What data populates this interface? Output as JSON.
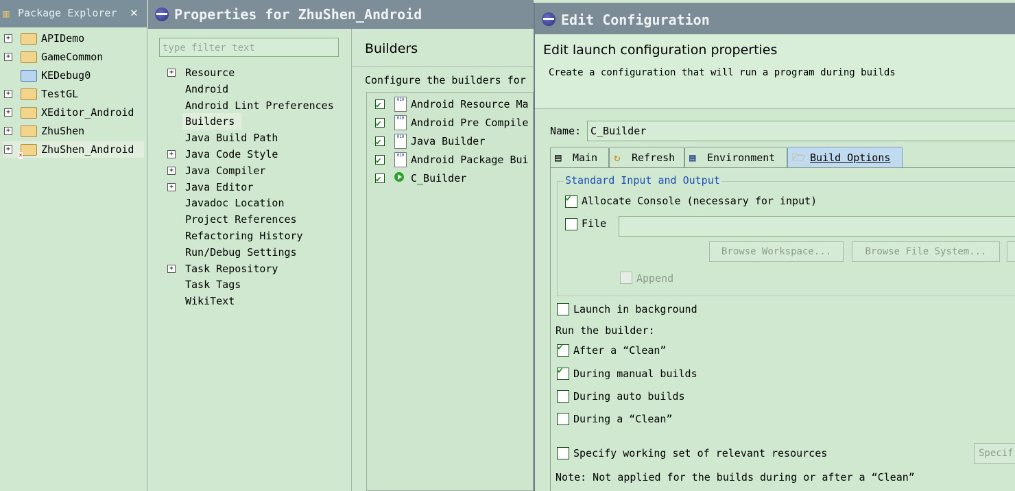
{
  "package_explorer": {
    "title": "Package Explorer",
    "projects": [
      {
        "label": "APIDemo",
        "icon": "project-folder-icon",
        "expandable": true
      },
      {
        "label": "GameCommon",
        "icon": "project-folder-icon",
        "expandable": true
      },
      {
        "label": "KEDebug0",
        "icon": "plain-folder-icon",
        "expandable": false
      },
      {
        "label": "TestGL",
        "icon": "project-folder-icon",
        "expandable": true
      },
      {
        "label": "XEditor_Android",
        "icon": "project-folder-icon",
        "expandable": true
      },
      {
        "label": "ZhuShen",
        "icon": "project-folder-icon",
        "expandable": true
      },
      {
        "label": "ZhuShen_Android",
        "icon": "project-error-icon",
        "expandable": true
      }
    ]
  },
  "properties": {
    "title": "Properties for ZhuShen_Android",
    "filter_placeholder": "type filter text",
    "nav": [
      {
        "label": "Resource",
        "expandable": true
      },
      {
        "label": "Android",
        "expandable": false
      },
      {
        "label": "Android Lint Preferences",
        "expandable": false
      },
      {
        "label": "Builders",
        "expandable": false,
        "selected": true
      },
      {
        "label": "Java Build Path",
        "expandable": false
      },
      {
        "label": "Java Code Style",
        "expandable": true
      },
      {
        "label": "Java Compiler",
        "expandable": true
      },
      {
        "label": "Java Editor",
        "expandable": true
      },
      {
        "label": "Javadoc Location",
        "expandable": false
      },
      {
        "label": "Project References",
        "expandable": false
      },
      {
        "label": "Refactoring History",
        "expandable": false
      },
      {
        "label": "Run/Debug Settings",
        "expandable": false
      },
      {
        "label": "Task Repository",
        "expandable": true
      },
      {
        "label": "Task Tags",
        "expandable": false
      },
      {
        "label": "WikiText",
        "expandable": false
      }
    ],
    "page_title": "Builders",
    "page_desc": "Configure the builders for",
    "builders": [
      {
        "label": "Android Resource Ma",
        "checked": true,
        "icon": "binary-builder-icon"
      },
      {
        "label": "Android Pre Compile",
        "checked": true,
        "icon": "binary-builder-icon"
      },
      {
        "label": "Java Builder",
        "checked": true,
        "icon": "binary-builder-icon"
      },
      {
        "label": "Android Package Bui",
        "checked": true,
        "icon": "binary-builder-icon"
      },
      {
        "label": "C_Builder",
        "checked": true,
        "icon": "program-builder-icon"
      }
    ]
  },
  "edit_config": {
    "title": "Edit Configuration",
    "header_title": "Edit launch configuration properties",
    "header_desc": "Create a configuration that will run a program during builds",
    "name_label": "Name:",
    "name_value": "C_Builder",
    "tabs": [
      {
        "label": "Main",
        "icon": "main-tab-icon",
        "active": false
      },
      {
        "label": "Refresh",
        "icon": "refresh-icon",
        "active": false
      },
      {
        "label": "Environment",
        "icon": "environment-icon",
        "active": false
      },
      {
        "label": "Build Options",
        "icon": "open-folder-icon",
        "active": true
      }
    ],
    "io_group_label": "Standard Input and Output",
    "allocate_console": {
      "label": "Allocate Console (necessary for input)",
      "checked": true
    },
    "file": {
      "label": "File",
      "checked": false,
      "value": ""
    },
    "browse_workspace": "Browse Workspace...",
    "browse_filesystem": "Browse File System...",
    "append": {
      "label": "Append",
      "checked": false
    },
    "launch_background": {
      "label": "Launch in background",
      "checked": false
    },
    "run_builder_label": "Run the builder:",
    "after_clean": {
      "label": "After a “Clean”",
      "checked": true
    },
    "during_manual": {
      "label": "During manual builds",
      "checked": true
    },
    "during_auto": {
      "label": "During auto builds",
      "checked": false
    },
    "during_clean": {
      "label": "During a “Clean”",
      "checked": false
    },
    "working_set": {
      "label": "Specify working set of relevant resources",
      "checked": false
    },
    "specify_button": "Specif",
    "note": "Note: Not applied for the builds during or after a “Clean”"
  },
  "colors": {
    "background": "#cfe8cf",
    "titlebar": "#7c8c97",
    "group_label": "#1f4fb6"
  }
}
